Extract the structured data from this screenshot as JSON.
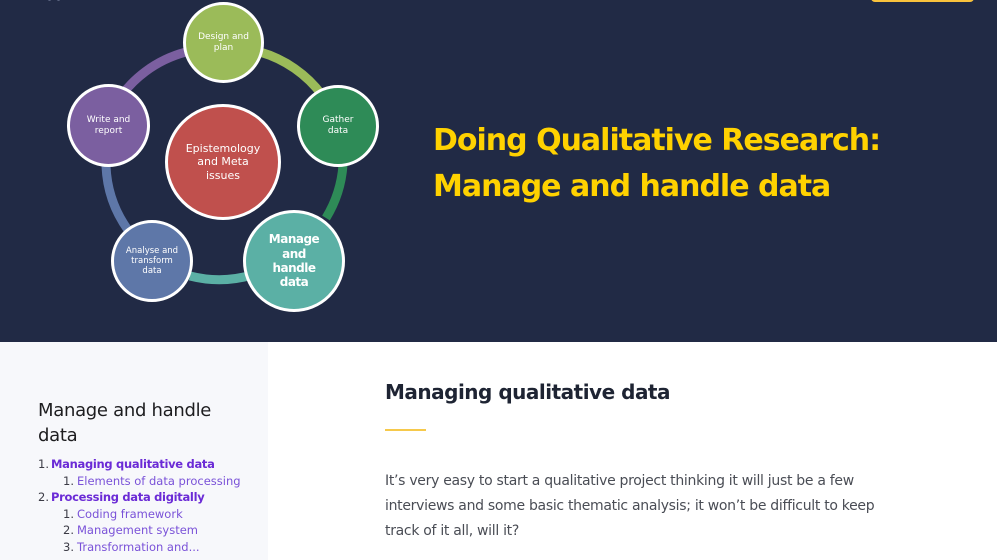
{
  "header": {
    "top_button_color": "#f9c23c"
  },
  "diagram": {
    "center": "Epistemology and Meta issues",
    "nodes": [
      {
        "label": "Design and plan",
        "color": "#9bbb59"
      },
      {
        "label": "Gather data",
        "color": "#2e8b57"
      },
      {
        "label": "Manage and handle data",
        "color": "#5bb0a5",
        "active": true
      },
      {
        "label": "Analyse and transform data",
        "color": "#5e77a8"
      },
      {
        "label": "Write and report",
        "color": "#7b5fa0"
      }
    ],
    "center_color": "#c0504d"
  },
  "hero": {
    "title_line1": "Doing Qualitative Research:",
    "title_line2": "Manage and handle data",
    "title_color": "#ffd200"
  },
  "sidebar": {
    "title": "Manage and handle data",
    "toc": [
      {
        "num": "1.",
        "label": "Managing qualitative data",
        "children": [
          {
            "num": "1.",
            "label": "Elements of data processing"
          }
        ]
      },
      {
        "num": "2.",
        "label": "Processing data digitally",
        "children": [
          {
            "num": "1.",
            "label": "Coding framework"
          },
          {
            "num": "2.",
            "label": "Management system"
          },
          {
            "num": "3.",
            "label": "Transformation and..."
          }
        ]
      }
    ]
  },
  "main": {
    "title": "Managing qualitative data",
    "paragraph": "It’s very easy to start a qualitative project thinking it will just be a few interviews and some basic thematic analysis; it won’t be difficult to keep track of it all, will it?"
  }
}
